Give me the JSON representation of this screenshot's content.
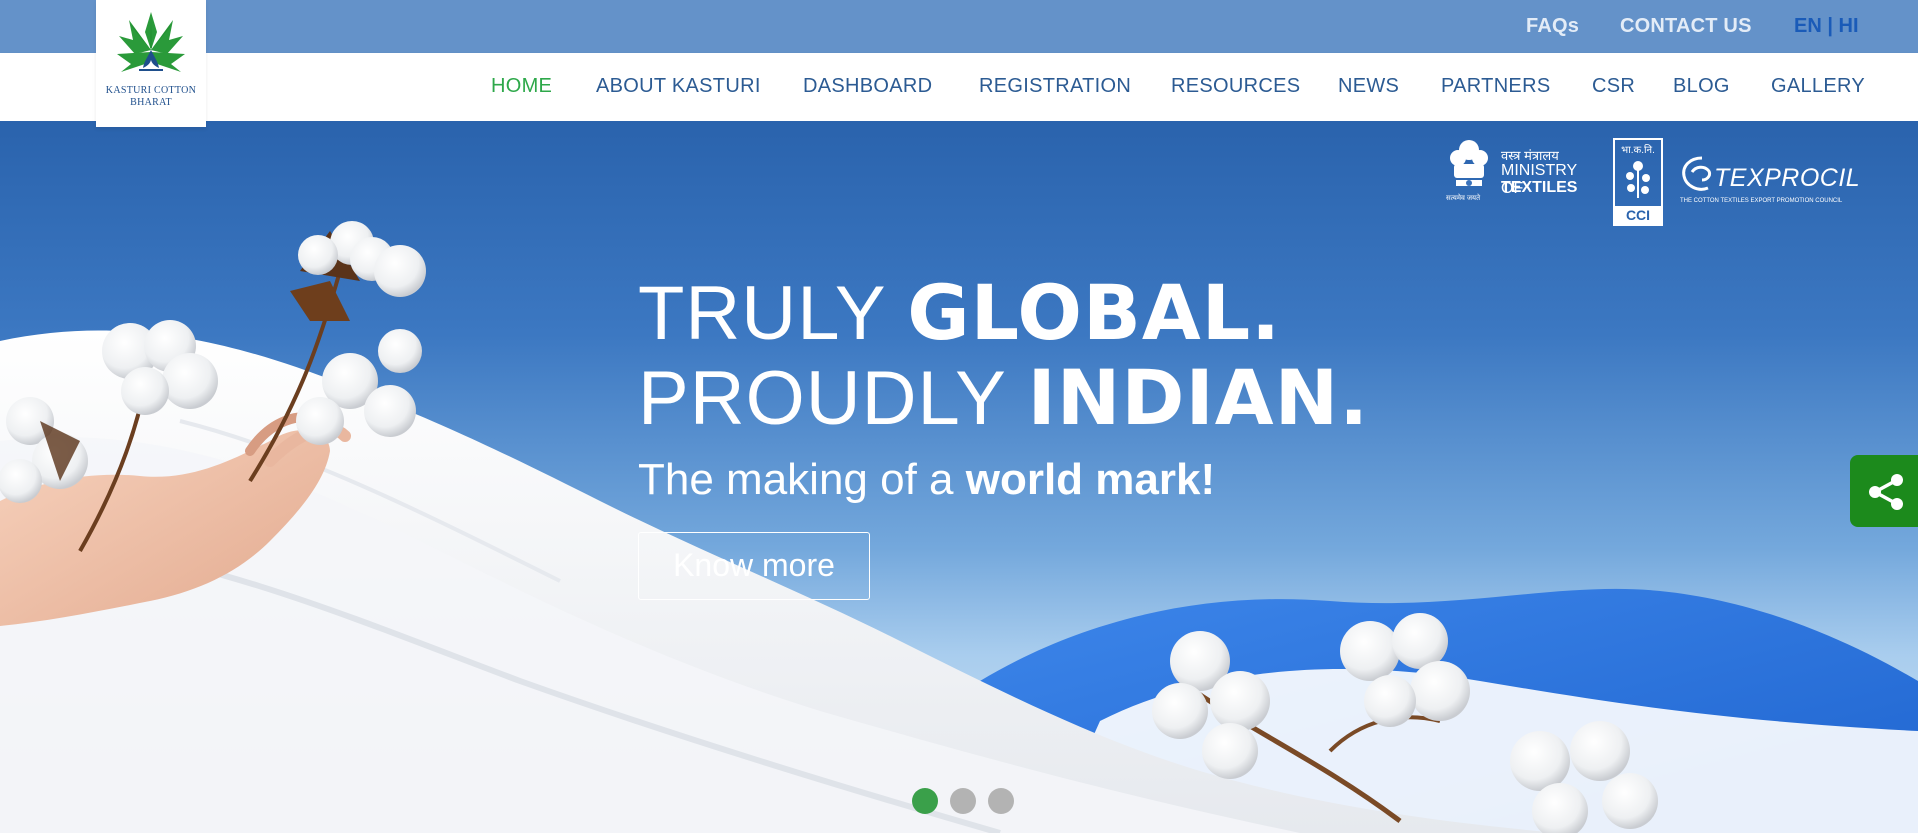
{
  "topbar": {
    "faq": "FAQs",
    "contact": "CONTACT US",
    "lang_en": "EN",
    "lang_sep": " | ",
    "lang_hi": "HI"
  },
  "logo": {
    "line1": "KASTURI COTTON",
    "line2": "BHARAT"
  },
  "nav": {
    "items": [
      {
        "label": "HOME",
        "active": true
      },
      {
        "label": "ABOUT KASTURI"
      },
      {
        "label": "DASHBOARD"
      },
      {
        "label": "REGISTRATION"
      },
      {
        "label": "RESOURCES"
      },
      {
        "label": "NEWS"
      },
      {
        "label": "PARTNERS"
      },
      {
        "label": "CSR"
      },
      {
        "label": "BLOG"
      },
      {
        "label": "GALLERY"
      }
    ]
  },
  "partners": {
    "ministry_hindi": "वस्त्र मंत्रालय",
    "ministry_line1": "MINISTRY OF",
    "ministry_line2": "TEXTILES",
    "emblem_motto": "सत्यमेव जयते",
    "cci_hindi": "भा.क.नि.",
    "cci": "CCI",
    "texprocil": "TEXPROCIL",
    "texprocil_sub": "THE COTTON TEXTILES EXPORT PROMOTION COUNCIL"
  },
  "hero": {
    "line1_thin": "TRULY ",
    "line1_bold": "GLOBAL.",
    "line2_thin": "PROUDLY ",
    "line2_bold": "INDIAN.",
    "sub_thin": "The making of a ",
    "sub_bold": "world mark!",
    "cta": "Know more",
    "slides_total": 3,
    "active_slide": 1
  },
  "colors": {
    "topbar": "#6492c9",
    "nav_text": "#2c5b93",
    "nav_active": "#2ea84a",
    "share": "#1c8a1c",
    "dot_active": "#3aa04a",
    "dot_inactive": "#b3b3b3"
  },
  "icons": {
    "share": "share-icon",
    "logo": "kasturi-leaf-logo"
  }
}
